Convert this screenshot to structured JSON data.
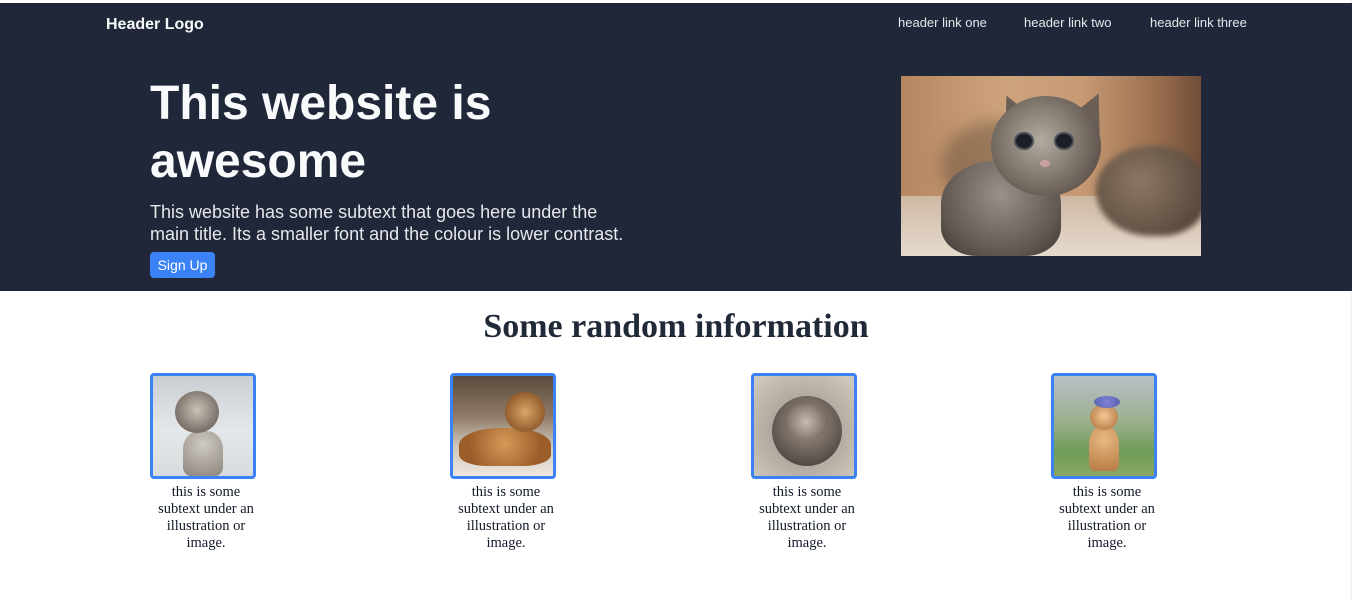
{
  "header": {
    "logo": "Header Logo",
    "links": [
      "header link one",
      "header link two",
      "header link three"
    ]
  },
  "hero": {
    "title": "This website is awesome",
    "subtext": "This website has some subtext that goes here under the main title. Its a smaller font and the colour is lower contrast.",
    "cta_label": "Sign Up",
    "image": "kitten-photo"
  },
  "info": {
    "title": "Some random information",
    "cards": [
      {
        "image": "kitten-photo",
        "caption": "this is some subtext under an illustration or image."
      },
      {
        "image": "bengal-cat-photo",
        "caption": "this is some subtext under an illustration or image."
      },
      {
        "image": "sleeping-kitten-photo",
        "caption": "this is some subtext under an illustration or image."
      },
      {
        "image": "cat-flower-crown-photo",
        "caption": "this is some subtext under an illustration or image."
      }
    ]
  },
  "colors": {
    "hero_bg": "#1f2738",
    "accent": "#3b82f6",
    "text_light": "#f9fafb"
  }
}
